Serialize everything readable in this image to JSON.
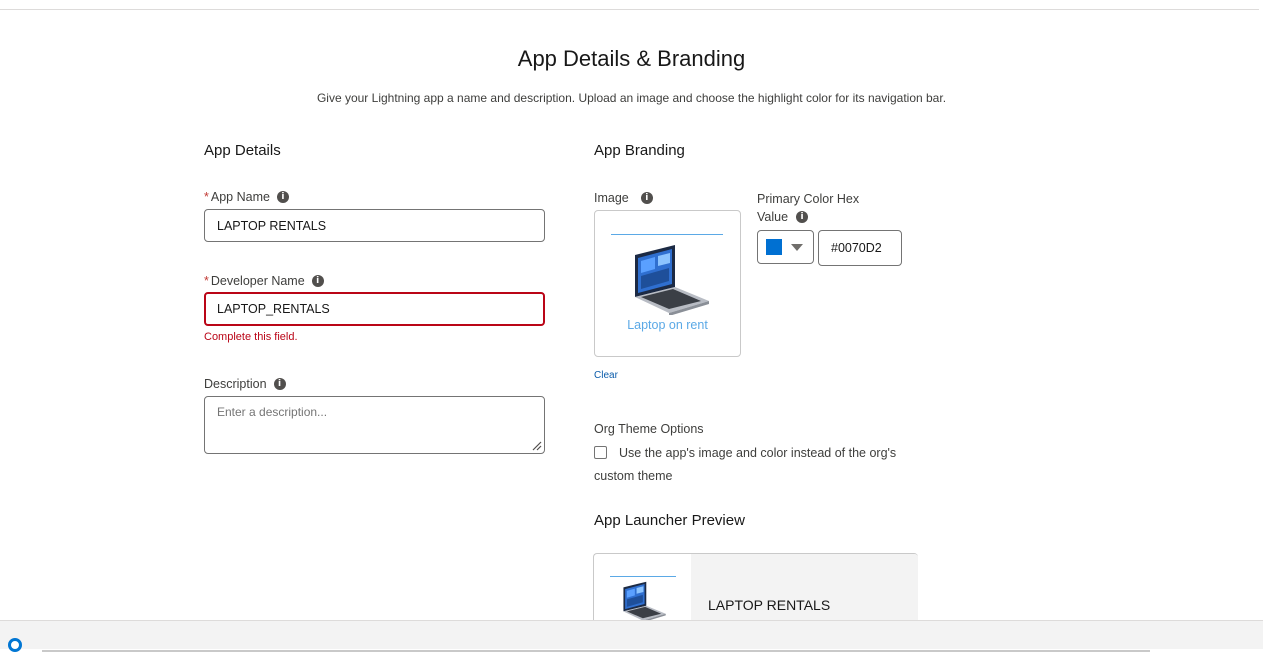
{
  "header": {
    "title": "App Details & Branding",
    "subtitle": "Give your Lightning app a name and description. Upload an image and choose the highlight color for its navigation bar."
  },
  "app_details": {
    "section_title": "App Details",
    "app_name": {
      "required_marker": "*",
      "label": "App Name",
      "value": "LAPTOP RENTALS"
    },
    "developer_name": {
      "required_marker": "*",
      "label": "Developer Name",
      "value": "LAPTOP_RENTALS",
      "error": "Complete this field."
    },
    "description": {
      "label": "Description",
      "placeholder": "Enter a description..."
    }
  },
  "app_branding": {
    "section_title": "App Branding",
    "image_label": "Image",
    "image_caption": "Laptop on rent",
    "clear_label": "Clear",
    "color_label_line1": "Primary Color Hex",
    "color_label_line2": "Value",
    "color_hex": "#0070D2",
    "swatch_color": "#0070d2",
    "org_theme": {
      "heading": "Org Theme Options",
      "checkbox_line1": "Use the app's image and color instead of the org's",
      "checkbox_line2": "custom theme",
      "checked": false
    },
    "preview": {
      "heading": "App Launcher Preview",
      "app_name": "LAPTOP RENTALS"
    }
  },
  "icons": {
    "info": "info-icon",
    "laptop": "laptop-icon",
    "caret": "chevron-down-icon",
    "resize": "resize-grip-icon"
  },
  "colors": {
    "error": "#ba0517",
    "accent": "#0176d3",
    "caption": "#5ba9e6"
  }
}
